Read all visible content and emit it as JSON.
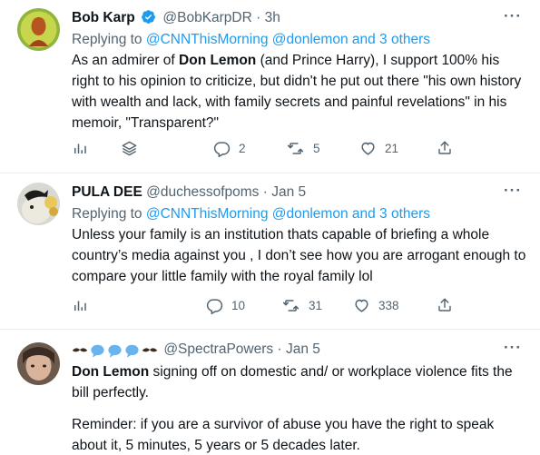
{
  "tweets": [
    {
      "name": "Bob Karp",
      "verified": true,
      "handle": "@BobKarpDR",
      "separator": "·",
      "time": "3h",
      "replying_prefix": "Replying to",
      "replying_to": "@CNNThisMorning @donlemon and 3 others",
      "body_1": "As an admirer of ",
      "body_bold": "Don Lemon",
      "body_2": " (and Prince Harry), I support 100% his right to his opinion to criticize, but didn't he put out there \"his own history with wealth and lack, with family secrets and painful revelations\" in his memoir, \"Transparent?\"",
      "replies": "2",
      "retweets": "5",
      "likes": "21",
      "more": "···"
    },
    {
      "name": "PULA DEE",
      "handle": "@duchessofpoms",
      "separator": "·",
      "time": "Jan 5",
      "replying_prefix": "Replying to",
      "replying_to": "@CNNThisMorning @donlemon and 3 others",
      "body": "Unless your family is an institution thats capable of briefing a whole country’s media against you , I don’t see how you are arrogant enough to compare your little family with the royal family lol",
      "replies": "10",
      "retweets": "31",
      "likes": "338",
      "more": "···"
    },
    {
      "handle": "@SpectraPowers",
      "separator": "·",
      "time": "Jan 5",
      "body_bold": "Don Lemon",
      "body_1": " signing off on domestic and/ or workplace violence fits the bill perfectly.",
      "body_2": "Reminder: if you are a survivor of abuse you have the right to speak about it, 5 minutes, 5 years or 5 decades later.",
      "more": "···"
    }
  ],
  "colors": {
    "accent": "#1d9bf0",
    "muted": "#536471",
    "text": "#0f1419",
    "divider": "#e6ecf0"
  },
  "icons": [
    "more-icon",
    "verified-badge-icon",
    "reply-icon",
    "retweet-icon",
    "like-icon",
    "share-icon",
    "analytics-icon",
    "stack-icon"
  ]
}
